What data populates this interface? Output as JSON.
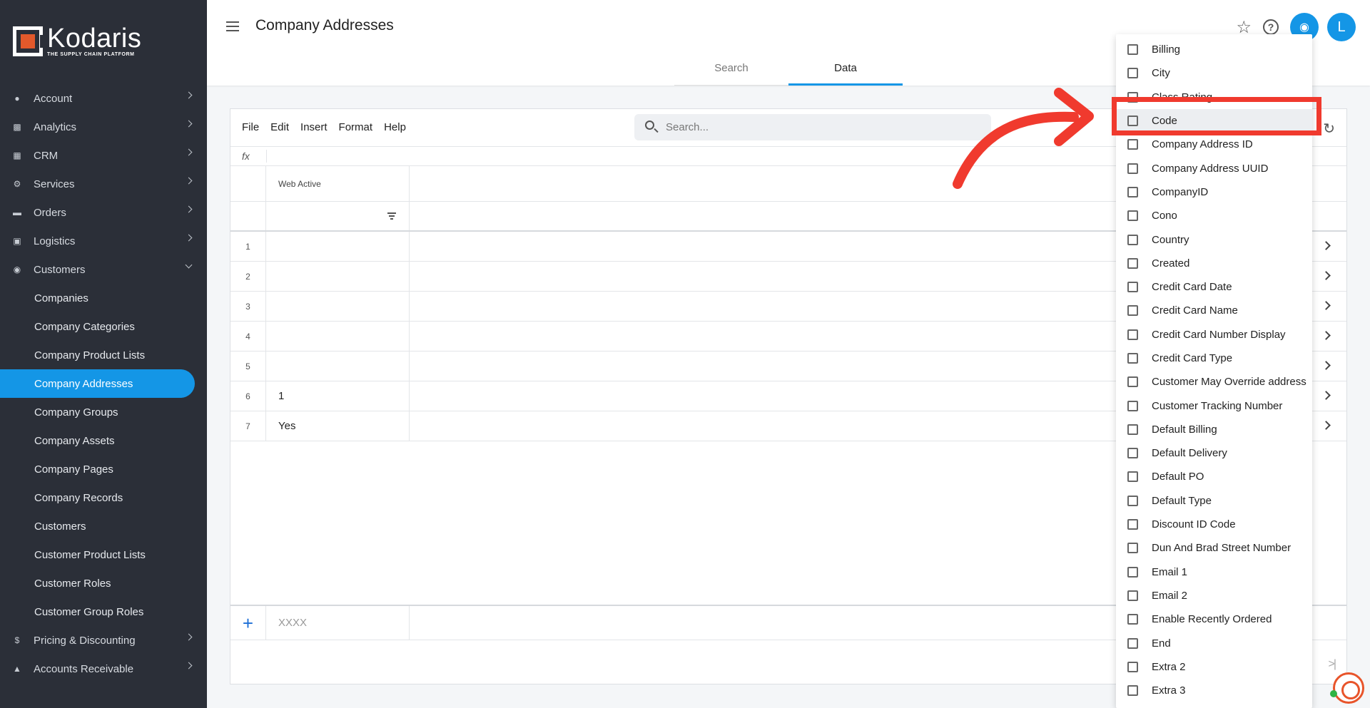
{
  "brand": {
    "name": "Kodaris",
    "tagline": "THE SUPPLY CHAIN PLATFORM",
    "accent": "#1496e6",
    "logo_orange": "#e2592b"
  },
  "sidebar": {
    "items": [
      {
        "label": "Account",
        "icon": "person-icon"
      },
      {
        "label": "Analytics",
        "icon": "chart-icon"
      },
      {
        "label": "CRM",
        "icon": "contact-card-icon"
      },
      {
        "label": "Services",
        "icon": "gears-icon"
      },
      {
        "label": "Orders",
        "icon": "truck-icon"
      },
      {
        "label": "Logistics",
        "icon": "delivery-icon"
      },
      {
        "label": "Customers",
        "icon": "people-icon",
        "expanded": true
      }
    ],
    "customers_sub": [
      "Companies",
      "Company Categories",
      "Company Product Lists",
      "Company Addresses",
      "Company Groups",
      "Company Assets",
      "Company Pages",
      "Company Records",
      "Customers",
      "Customer Product Lists",
      "Customer Roles",
      "Customer Group Roles"
    ],
    "active_sub": "Company Addresses",
    "after_items": [
      {
        "label": "Pricing & Discounting",
        "icon": "dollar-icon"
      },
      {
        "label": "Accounts Receivable",
        "icon": "bank-icon"
      }
    ]
  },
  "header": {
    "title": "Company Addresses",
    "tabs": [
      "Search",
      "Data"
    ],
    "active_tab": "Data",
    "avatar_initial": "L"
  },
  "toolbar": {
    "menu": [
      "File",
      "Edit",
      "Insert",
      "Format",
      "Help"
    ],
    "search_placeholder": "Search...",
    "fx_label": "fx"
  },
  "grid": {
    "columns": [
      "Web Active"
    ],
    "rows": [
      {
        "n": "1",
        "web_active": ""
      },
      {
        "n": "2",
        "web_active": ""
      },
      {
        "n": "3",
        "web_active": ""
      },
      {
        "n": "4",
        "web_active": ""
      },
      {
        "n": "5",
        "web_active": ""
      },
      {
        "n": "6",
        "web_active": "1"
      },
      {
        "n": "7",
        "web_active": "Yes"
      }
    ],
    "new_row_placeholder": "XXXX"
  },
  "column_chooser": {
    "items": [
      "Billing",
      "City",
      "Class Rating",
      "Code",
      "Company Address ID",
      "Company Address UUID",
      "CompanyID",
      "Cono",
      "Country",
      "Created",
      "Credit Card Date",
      "Credit Card Name",
      "Credit Card Number Display",
      "Credit Card Type",
      "Customer May Override address",
      "Customer Tracking Number",
      "Default Billing",
      "Default Delivery",
      "Default PO",
      "Default Type",
      "Discount ID Code",
      "Dun And Brad Street Number",
      "Email 1",
      "Email 2",
      "Enable Recently Ordered",
      "End",
      "Extra 2",
      "Extra 3"
    ],
    "highlighted": "Code"
  },
  "annotation_color": "#f03a2e"
}
